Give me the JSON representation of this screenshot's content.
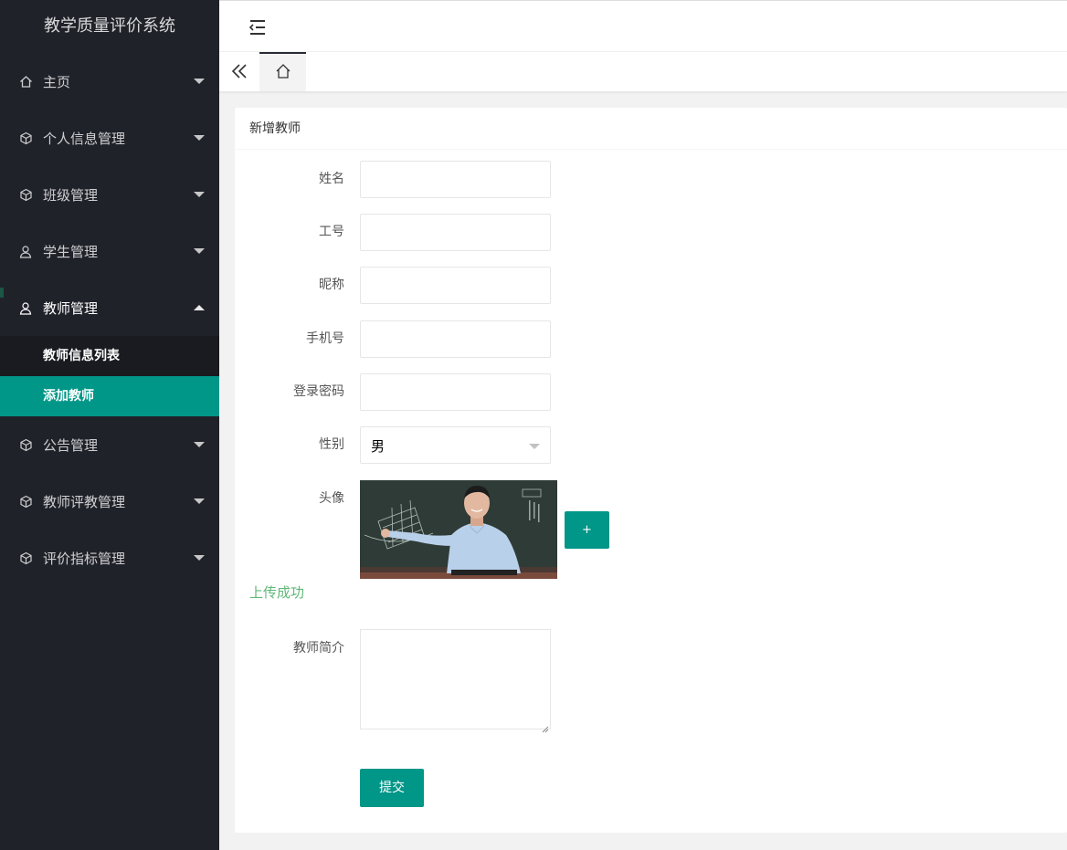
{
  "app": {
    "title": "教学质量评价系统"
  },
  "sidebar": {
    "items": [
      {
        "label": "主页",
        "icon": "home-icon"
      },
      {
        "label": "个人信息管理",
        "icon": "cube-icon"
      },
      {
        "label": "班级管理",
        "icon": "cube-icon"
      },
      {
        "label": "学生管理",
        "icon": "user-icon"
      },
      {
        "label": "教师管理",
        "icon": "user-icon"
      },
      {
        "label": "公告管理",
        "icon": "cube-icon"
      },
      {
        "label": "教师评教管理",
        "icon": "cube-icon"
      },
      {
        "label": "评价指标管理",
        "icon": "cube-icon"
      }
    ],
    "sub_items": [
      {
        "label": "教师信息列表"
      },
      {
        "label": "添加教师"
      }
    ]
  },
  "form": {
    "title": "新增教师",
    "fields": {
      "name": {
        "label": "姓名",
        "value": ""
      },
      "job_number": {
        "label": "工号",
        "value": ""
      },
      "nickname": {
        "label": "昵称",
        "value": ""
      },
      "phone": {
        "label": "手机号",
        "value": ""
      },
      "password": {
        "label": "登录密码",
        "value": ""
      },
      "gender": {
        "label": "性别",
        "value": "男"
      },
      "avatar": {
        "label": "头像"
      },
      "bio": {
        "label": "教师简介",
        "value": ""
      }
    },
    "upload_button": "+",
    "upload_status": "上传成功",
    "submit_label": "提交"
  },
  "colors": {
    "accent": "#009688",
    "sidebar_bg": "#20222a",
    "success_text": "#5fb878"
  }
}
